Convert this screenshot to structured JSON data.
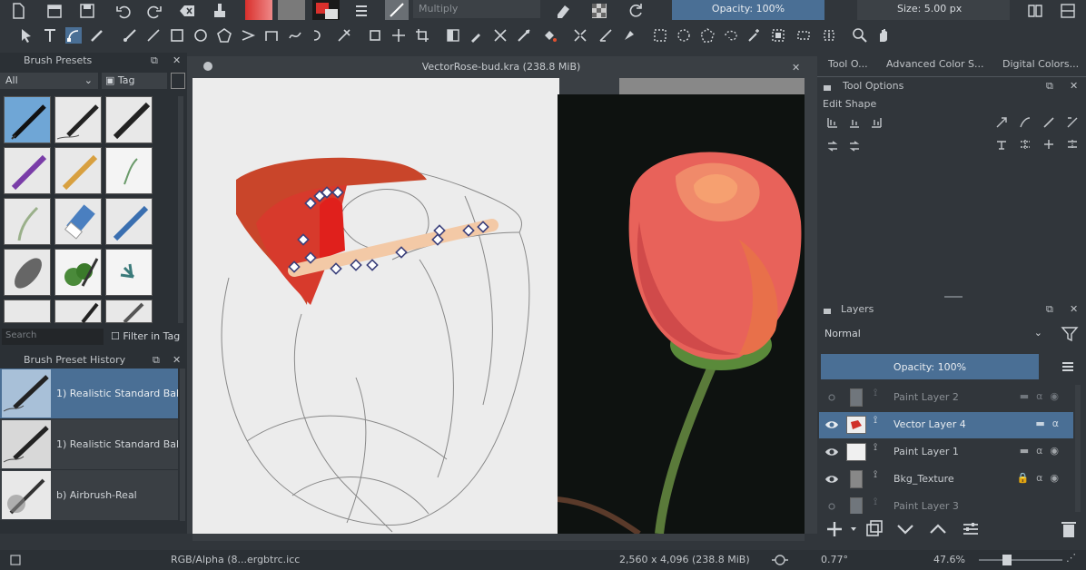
{
  "toolbar": {
    "blend_mode": "Multiply",
    "opacity_label": "Opacity: 100%",
    "size_label": "Size: 5.00 px",
    "colors": {
      "accent": "#4a6f95",
      "fg_swatch": "#d9302c"
    }
  },
  "brush_presets": {
    "title": "Brush Presets",
    "filter_value": "All",
    "tag_label": "Tag",
    "search_placeholder": "Search",
    "filter_in_tag": "Filter in Tag"
  },
  "preset_history": {
    "title": "Brush Preset History",
    "items": [
      {
        "label": "1) Realistic Standard Bal"
      },
      {
        "label": "1) Realistic Standard Bal"
      },
      {
        "label": "b) Airbrush-Real"
      }
    ]
  },
  "document": {
    "tab_title": "VectorRose-bud.kra (238.8 MiB)"
  },
  "right_tabs": [
    "Tool O...",
    "Advanced Color S...",
    "Digital Colors..."
  ],
  "tool_options": {
    "title": "Tool Options",
    "section": "Edit Shape"
  },
  "layers": {
    "title": "Layers",
    "blend_mode": "Normal",
    "opacity_label": "Opacity:  100%",
    "items": [
      {
        "name": "Paint Layer 2"
      },
      {
        "name": "Vector Layer 4"
      },
      {
        "name": "Paint Layer 1"
      },
      {
        "name": "Bkg_Texture"
      },
      {
        "name": "Paint Layer 3"
      }
    ]
  },
  "status": {
    "color_profile": "RGB/Alpha (8...ergbtrc.icc",
    "dimensions": "2,560 x 4,096 (238.8 MiB)",
    "rotation": "0.77°",
    "zoom": "47.6%"
  }
}
